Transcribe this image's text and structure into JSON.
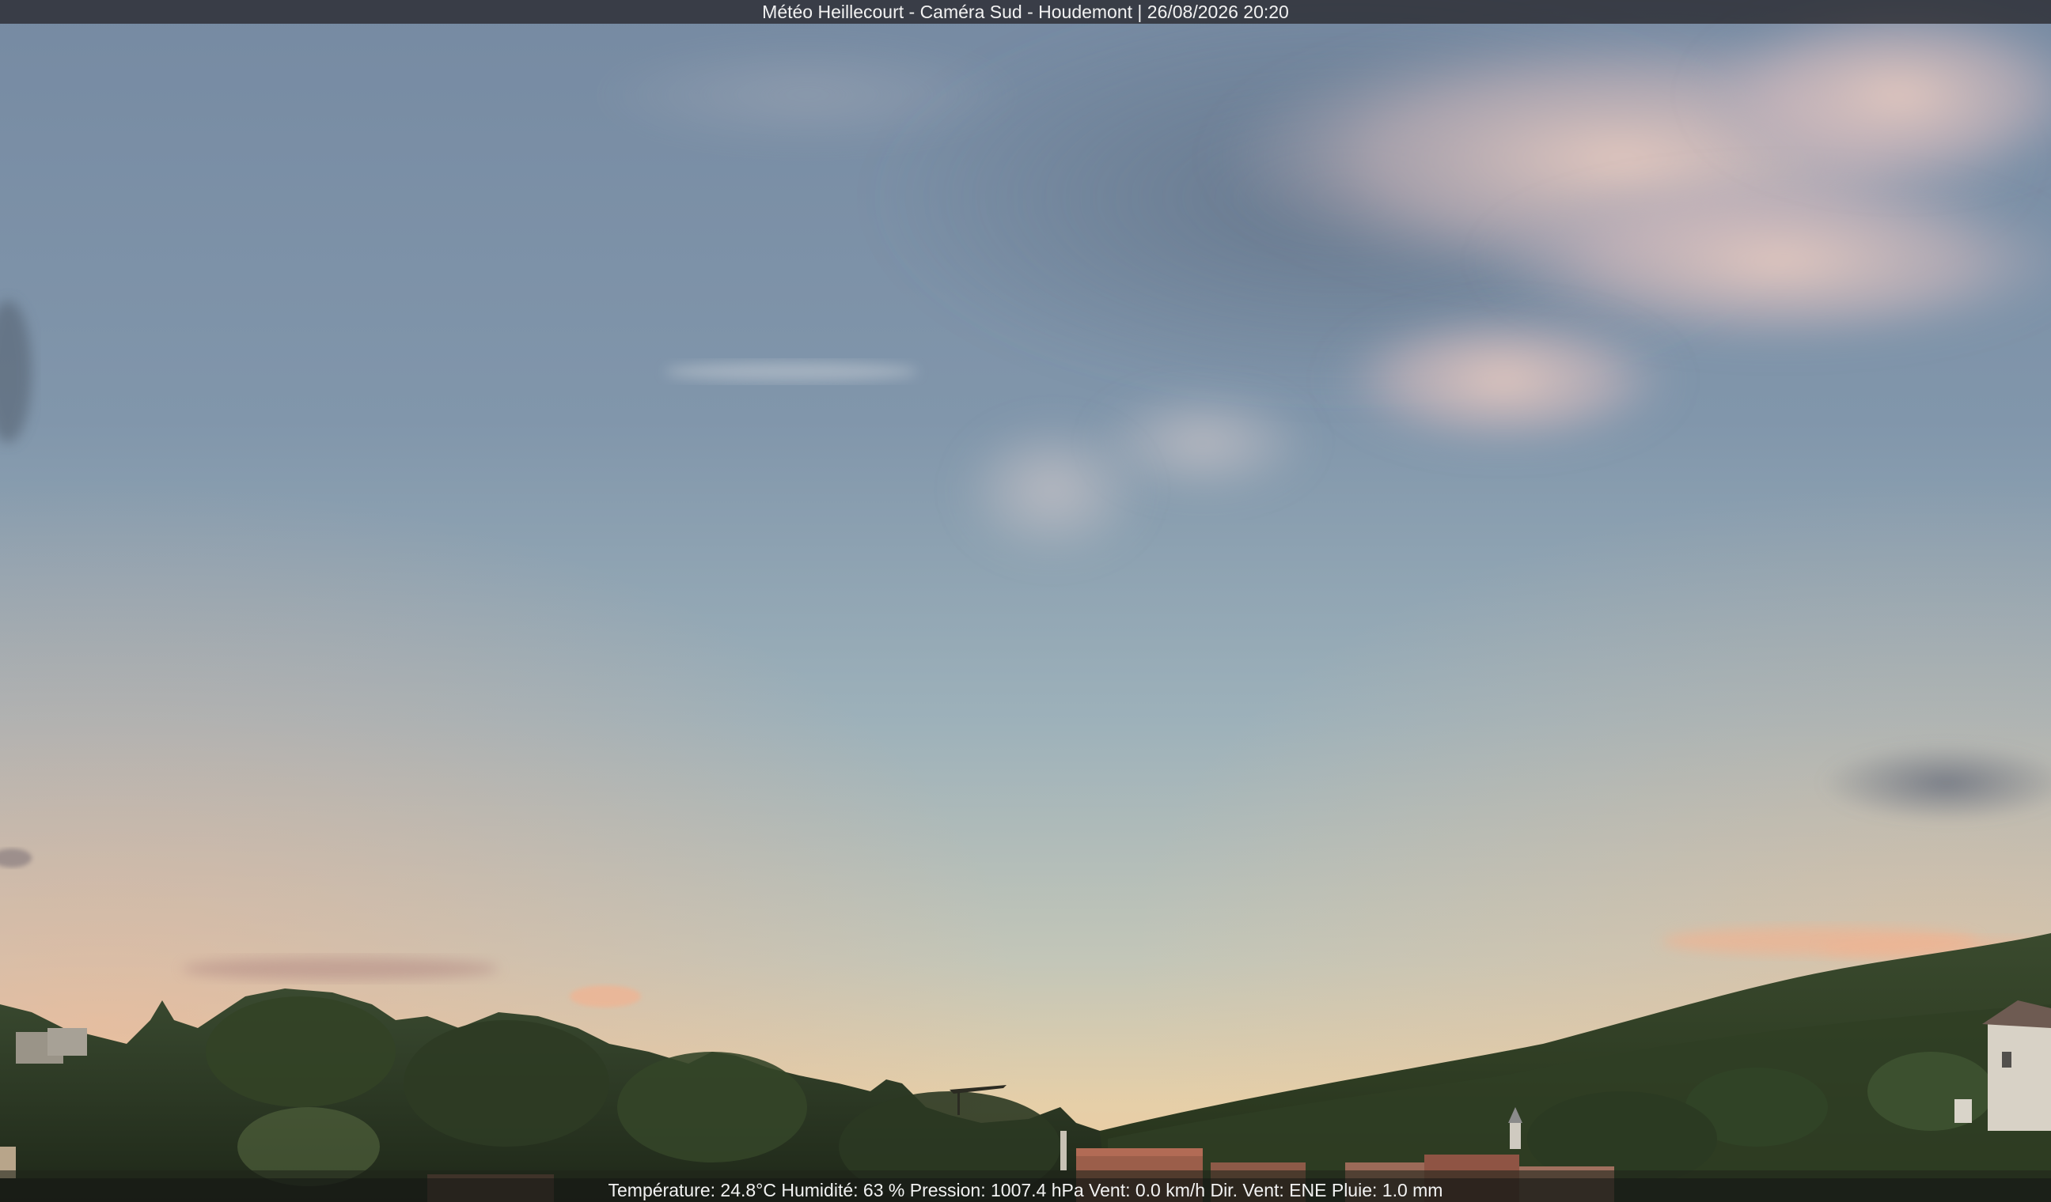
{
  "overlay": {
    "title": "Météo Heillecourt - Caméra Sud - Houdemont | 26/08/2026 20:20",
    "readings": "Température: 24.8°C  Humidité: 63 % Pression: 1007.4 hPa Vent: 0.0 km/h Dir. Vent: ENE Pluie: 1.0 mm"
  },
  "colors": {
    "sky_top": "#7a8ea6",
    "sky_mid": "#93aab8",
    "sky_horizon": "#e9cfa8",
    "sunset_glow": "#f0b48c",
    "trees": "#2c3a24",
    "hill": "#344628"
  }
}
